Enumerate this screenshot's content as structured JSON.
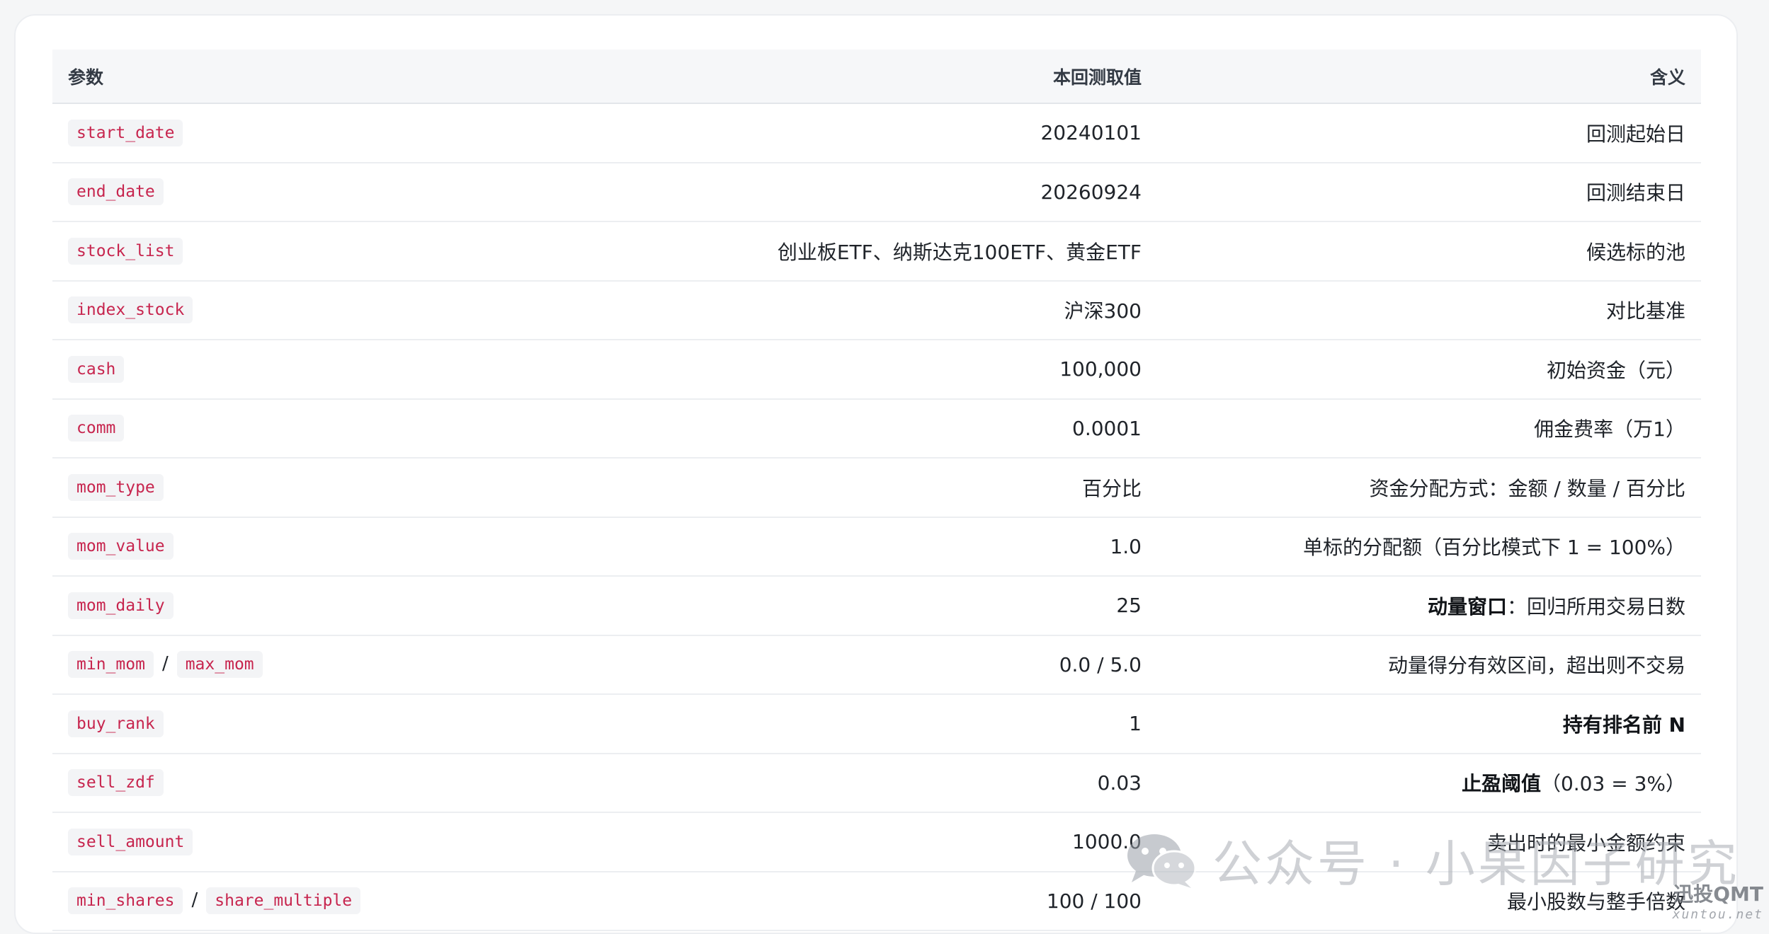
{
  "table": {
    "headers": [
      "参数",
      "本回测取值",
      "含义"
    ],
    "rows": [
      {
        "params": [
          "start_date"
        ],
        "value": "20240101",
        "meaning_bold": "",
        "meaning": "回测起始日"
      },
      {
        "params": [
          "end_date"
        ],
        "value": "20260924",
        "meaning_bold": "",
        "meaning": "回测结束日"
      },
      {
        "params": [
          "stock_list"
        ],
        "value": "创业板ETF、纳斯达克100ETF、黄金ETF",
        "meaning_bold": "",
        "meaning": "候选标的池"
      },
      {
        "params": [
          "index_stock"
        ],
        "value": "沪深300",
        "meaning_bold": "",
        "meaning": "对比基准"
      },
      {
        "params": [
          "cash"
        ],
        "value": "100,000",
        "meaning_bold": "",
        "meaning": "初始资金（元）"
      },
      {
        "params": [
          "comm"
        ],
        "value": "0.0001",
        "meaning_bold": "",
        "meaning": "佣金费率（万1）"
      },
      {
        "params": [
          "mom_type"
        ],
        "value": "百分比",
        "meaning_bold": "",
        "meaning": "资金分配方式：金额 / 数量 / 百分比"
      },
      {
        "params": [
          "mom_value"
        ],
        "value": "1.0",
        "meaning_bold": "",
        "meaning": "单标的分配额（百分比模式下 1 = 100%）"
      },
      {
        "params": [
          "mom_daily"
        ],
        "value": "25",
        "meaning_bold": "动量窗口",
        "meaning": "：回归所用交易日数"
      },
      {
        "params": [
          "min_mom",
          "max_mom"
        ],
        "value": "0.0 / 5.0",
        "meaning_bold": "",
        "meaning": "动量得分有效区间，超出则不交易"
      },
      {
        "params": [
          "buy_rank"
        ],
        "value": "1",
        "meaning_bold": "持有排名前 N",
        "meaning": ""
      },
      {
        "params": [
          "sell_zdf"
        ],
        "value": "0.03",
        "meaning_bold": "止盈阈值",
        "meaning": "（0.03 = 3%）"
      },
      {
        "params": [
          "sell_amount"
        ],
        "value": "1000.0",
        "meaning_bold": "",
        "meaning": "卖出时的最小金额约束"
      },
      {
        "params": [
          "min_shares",
          "share_multiple"
        ],
        "value": "100 / 100",
        "meaning_bold": "",
        "meaning": "最小股数与整手倍数"
      }
    ],
    "param_separator": "/"
  },
  "watermark": {
    "text": "公众号 · 小果因子研究",
    "icon": "wechat-icon"
  },
  "brand": {
    "name": "迅投QMT",
    "domain": "xuntou.net"
  },
  "colors": {
    "code_text": "#c7254e",
    "code_bg": "#f3f4f6",
    "header_bg": "#f6f7f9"
  }
}
